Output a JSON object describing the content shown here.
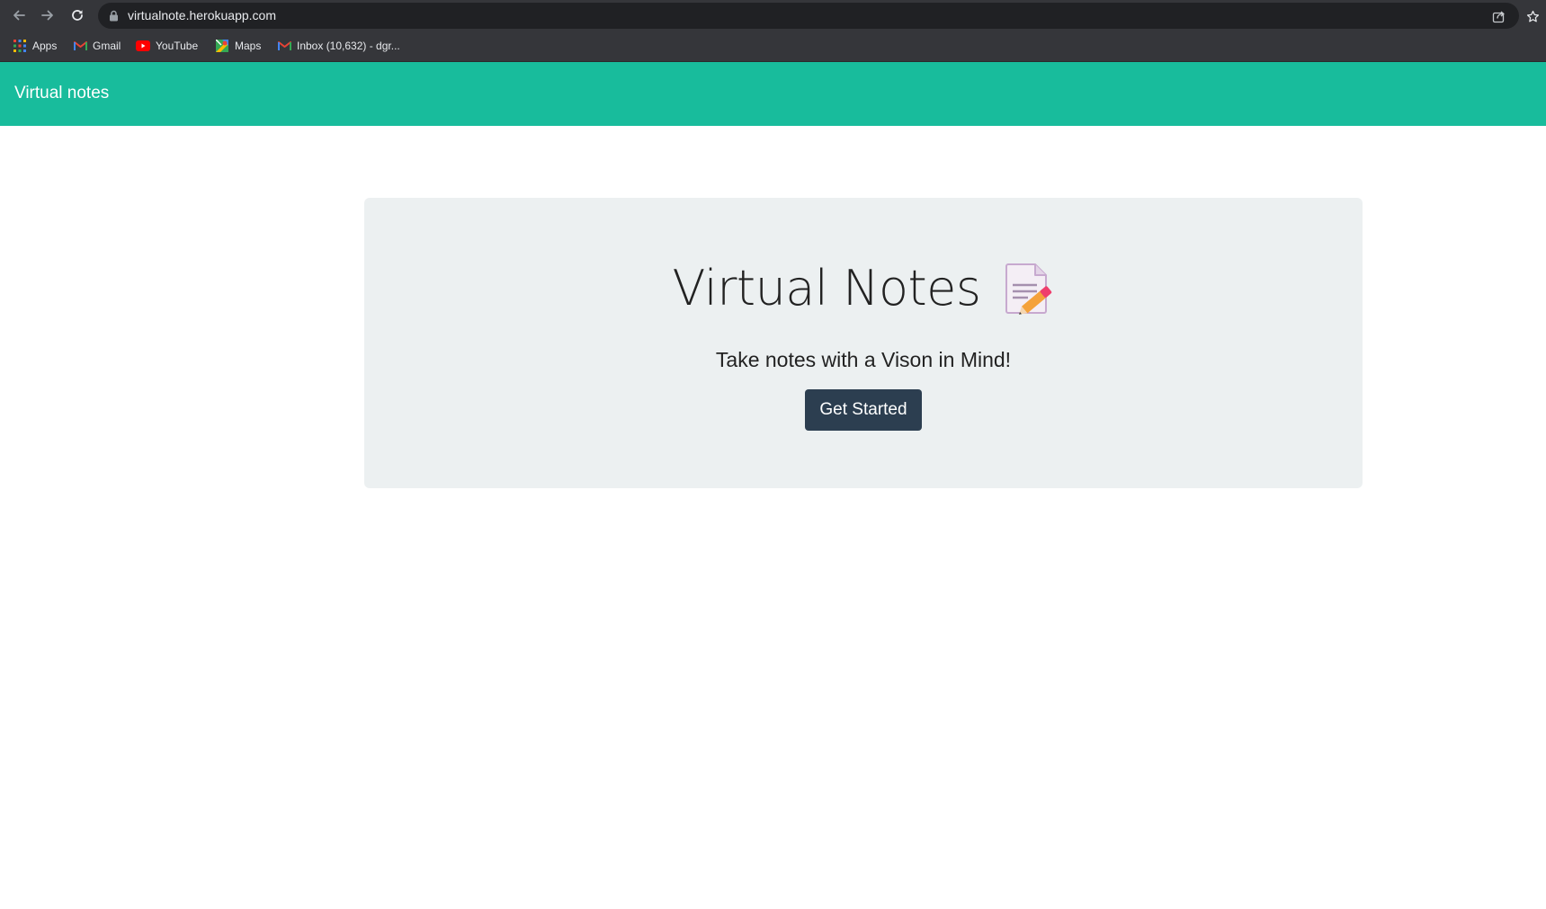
{
  "browser": {
    "url": "virtualnote.herokuapp.com",
    "bookmarks": [
      {
        "label": "Apps",
        "icon": "apps-grid-icon"
      },
      {
        "label": "Gmail",
        "icon": "gmail-icon"
      },
      {
        "label": "YouTube",
        "icon": "youtube-icon"
      },
      {
        "label": "Maps",
        "icon": "maps-icon"
      },
      {
        "label": "Inbox (10,632) - dgr...",
        "icon": "gmail-icon"
      }
    ]
  },
  "navbar": {
    "brand": "Virtual notes",
    "color": "#18bc9c"
  },
  "hero": {
    "title": "Virtual Notes",
    "icon": "memo-icon",
    "lead": "Take notes with a Vison in Mind!",
    "button_label": "Get Started",
    "background": "#ecf0f1",
    "button_color": "#2c3e50"
  }
}
